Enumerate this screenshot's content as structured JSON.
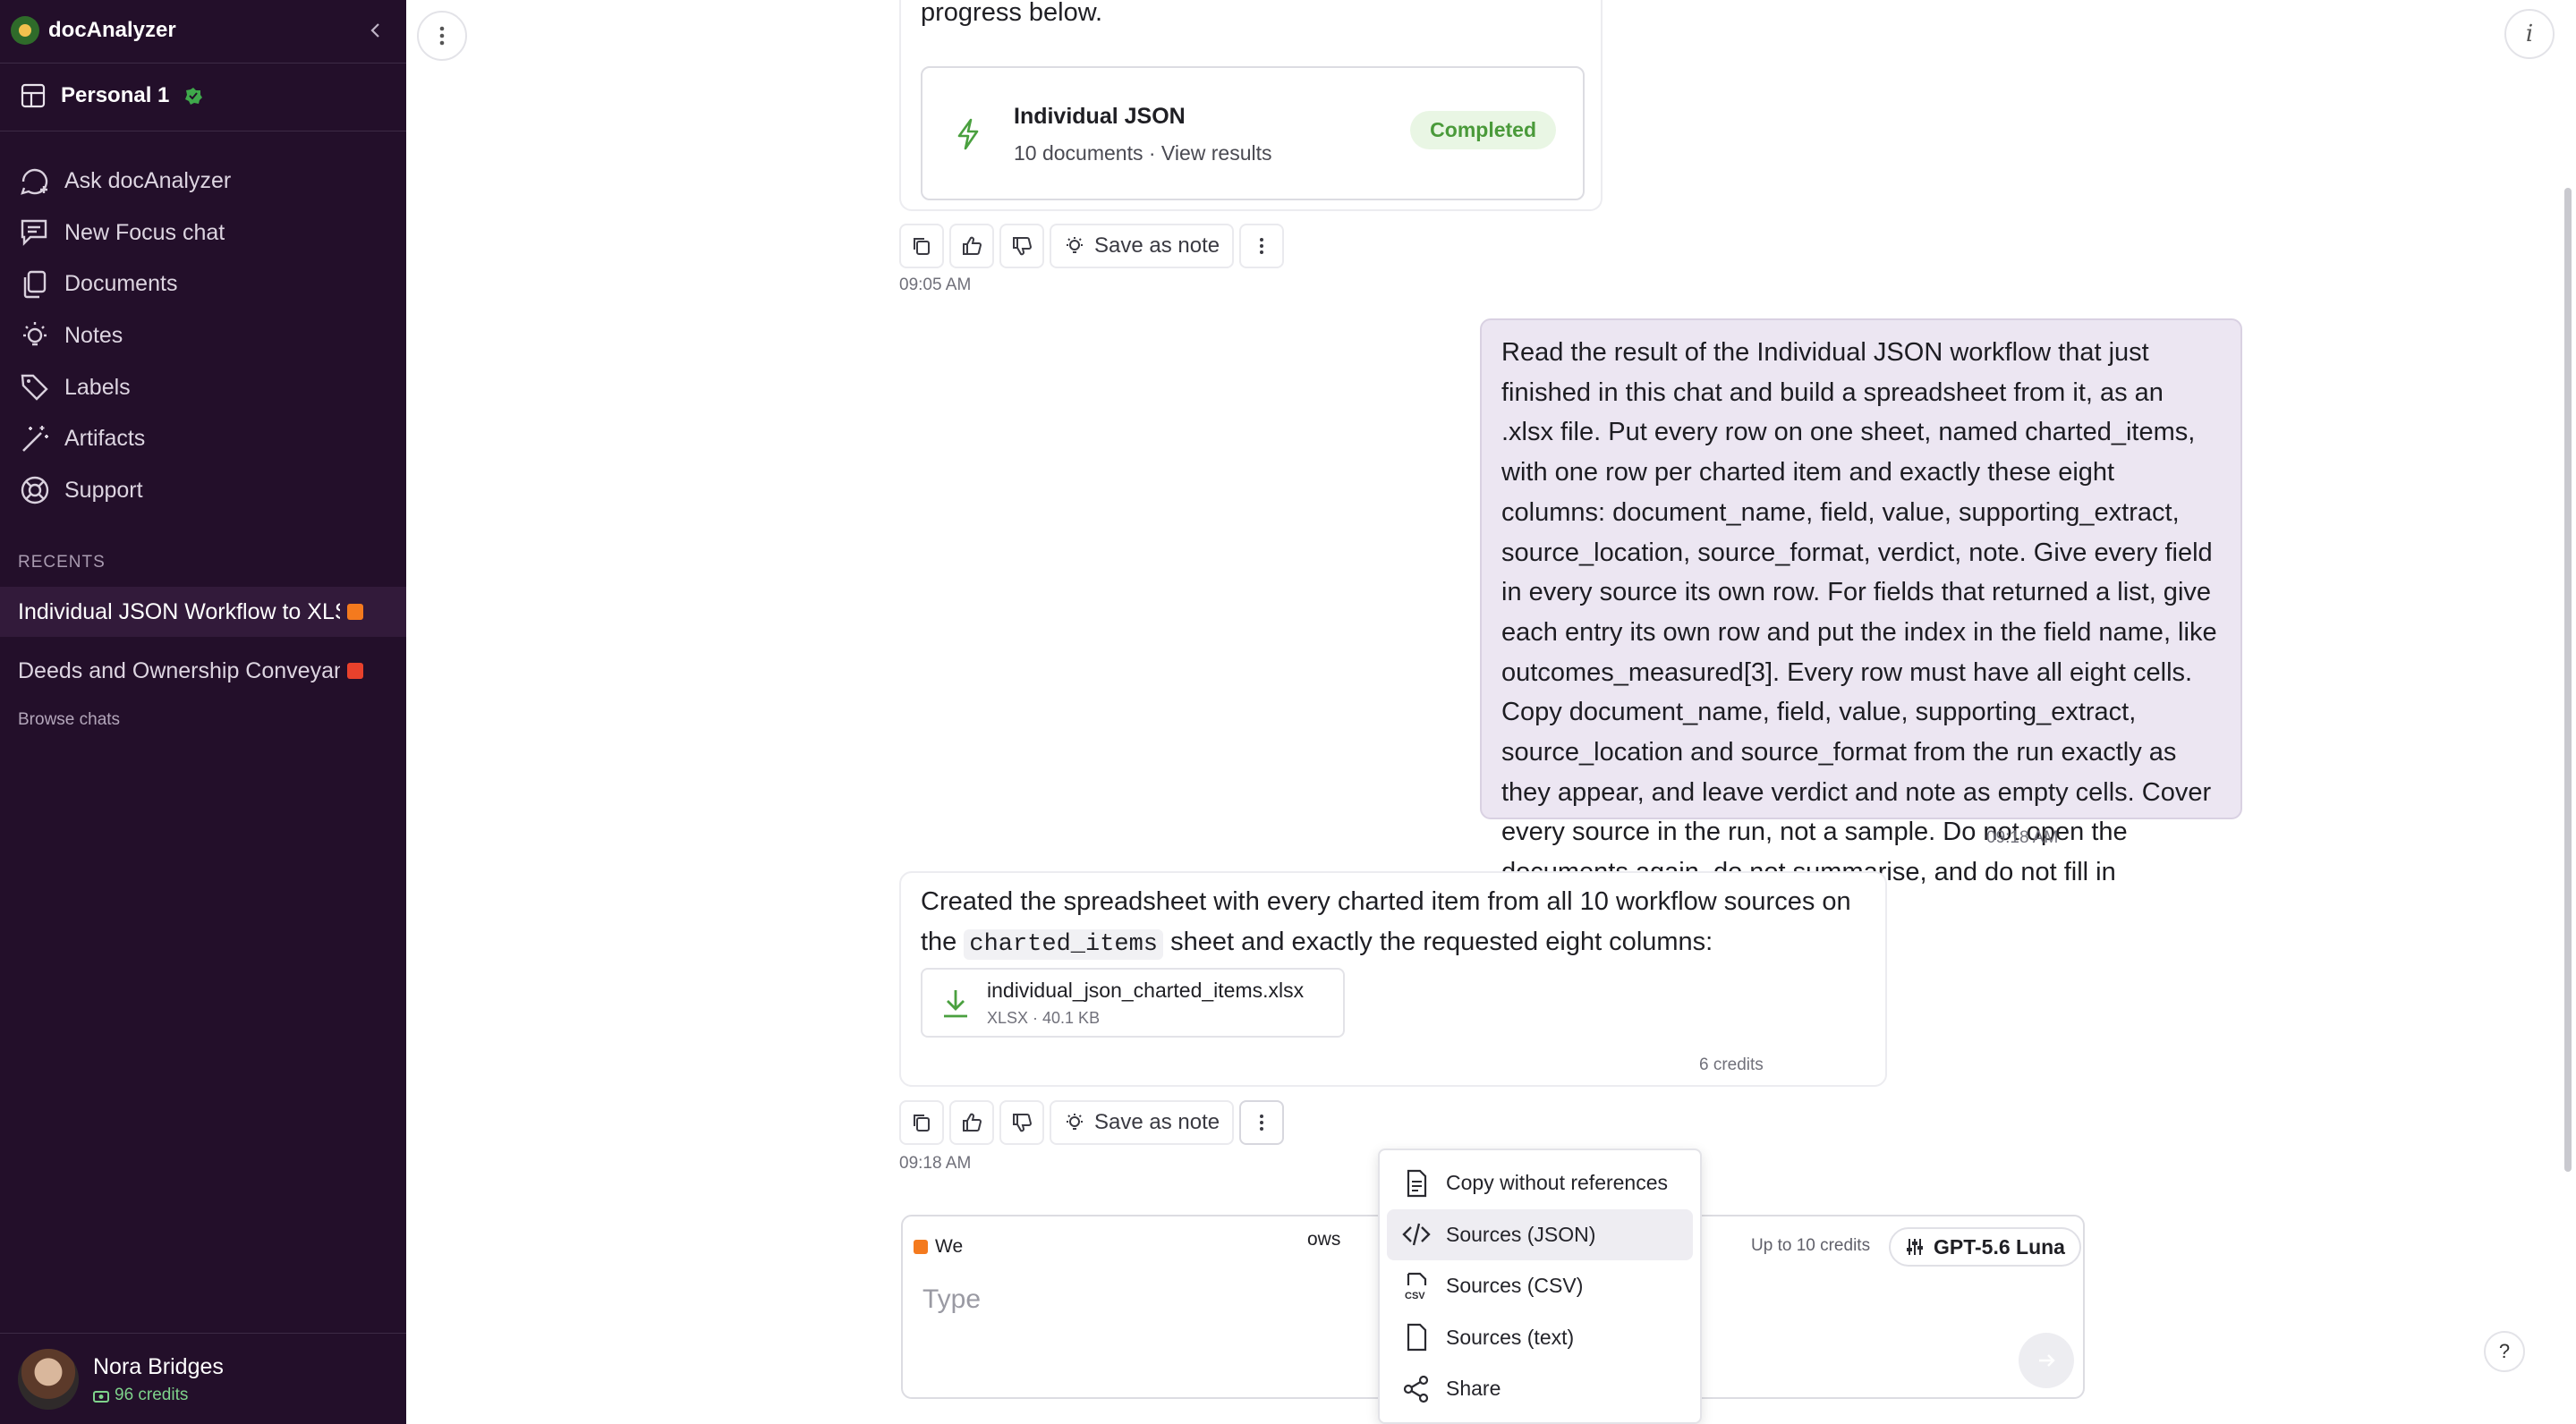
{
  "sidebar": {
    "brand": "docAnalyzer",
    "workspace": "Personal 1",
    "nav": [
      {
        "label": "Ask docAnalyzer",
        "icon": "chat-plus-icon"
      },
      {
        "label": "New Focus chat",
        "icon": "focus-chat-icon"
      },
      {
        "label": "Documents",
        "icon": "documents-icon"
      },
      {
        "label": "Notes",
        "icon": "lightbulb-icon"
      },
      {
        "label": "Labels",
        "icon": "tag-icon"
      },
      {
        "label": "Artifacts",
        "icon": "wand-icon"
      },
      {
        "label": "Support",
        "icon": "lifebuoy-icon"
      }
    ],
    "recents_heading": "RECENTS",
    "recents": [
      {
        "title": "Individual JSON Workflow to XLSX Spreadsheet",
        "color": "#f47a1e"
      },
      {
        "title": "Deeds and Ownership Conveyance",
        "color": "#e8412c"
      }
    ],
    "browse": "Browse chats",
    "user": {
      "name": "Nora Bridges",
      "credits": "96 credits"
    }
  },
  "chat": {
    "top_card": {
      "lead": "progress below.",
      "workflow_title": "Individual JSON",
      "workflow_sub": "10 documents · View results",
      "badge": "Completed"
    },
    "save_note": "Save as note",
    "time1": "09:05 AM",
    "user_message": "Read the result of the Individual JSON workflow that just finished in this chat and build a spreadsheet from it, as an .xlsx file. Put every row on one sheet, named charted_items, with one row per charted item and exactly these eight columns: document_name, field, value, supporting_extract, source_location, source_format, verdict, note. Give every field in every source its own row. For fields that returned a list, give each entry its own row and put the index in the field name, like outcomes_measured[3]. Every row must have all eight cells. Copy document_name, field, value, supporting_extract, source_location and source_format from the run exactly as they appear, and leave verdict and note as empty cells. Cover every source in the run, not a sample. Do not open the documents again, do not summarise, and do not fill in anything the workflow left empty.",
    "time2": "09:18 AM",
    "reply": {
      "before": "Created the spreadsheet with every charted item from all 10 workflow sources on the ",
      "code": "charted_items",
      "after": " sheet and exactly the requested eight columns:",
      "file_name": "individual_json_charted_items.xlsx",
      "file_meta": "XLSX · 40.1 KB",
      "credits": "6 credits"
    },
    "time3": "09:18 AM"
  },
  "menu": {
    "items": [
      {
        "label": "Copy without references",
        "icon": "document-icon"
      },
      {
        "label": "Sources (JSON)",
        "icon": "code-icon"
      },
      {
        "label": "Sources (CSV)",
        "icon": "csv-file-icon"
      },
      {
        "label": "Sources (text)",
        "icon": "file-icon"
      },
      {
        "label": "Share",
        "icon": "share-icon"
      }
    ]
  },
  "composer": {
    "web_chip": "We",
    "workflows_chip": "ows",
    "up_to": "Up to 10 credits",
    "model": "GPT-5.6 Luna",
    "placeholder": "Type"
  },
  "help": "?",
  "info_icon_text": "i"
}
